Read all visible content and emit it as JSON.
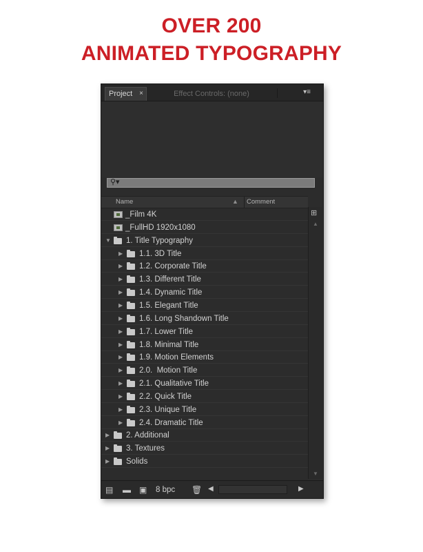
{
  "headline": {
    "line1": "OVER 200",
    "line2": "ANIMATED TYPOGRAPHY",
    "color": "#cc1f26"
  },
  "panel": {
    "tabs": {
      "project": "Project",
      "project_close": "×",
      "effect_controls": "Effect Controls: (none)",
      "menu": "▾≡"
    },
    "search": {
      "icon": "magnifier-icon",
      "glyph": "⚲▾"
    },
    "columns": {
      "name": "Name",
      "sort": "▲",
      "comment": "Comment"
    },
    "items": [
      {
        "label": "_Film 4K",
        "type": "composition",
        "level": 0,
        "expand": ""
      },
      {
        "label": "_FullHD 1920x1080",
        "type": "composition",
        "level": 0,
        "expand": ""
      },
      {
        "label": "1. Title Typography",
        "type": "folder",
        "level": 0,
        "expand": "▼"
      },
      {
        "label": "1.1. 3D Title",
        "type": "folder",
        "level": 1,
        "expand": "▶"
      },
      {
        "label": "1.2. Corporate Title",
        "type": "folder",
        "level": 1,
        "expand": "▶"
      },
      {
        "label": "1.3. Different Title",
        "type": "folder",
        "level": 1,
        "expand": "▶"
      },
      {
        "label": "1.4. Dynamic Title",
        "type": "folder",
        "level": 1,
        "expand": "▶"
      },
      {
        "label": "1.5. Elegant Title",
        "type": "folder",
        "level": 1,
        "expand": "▶"
      },
      {
        "label": "1.6. Long Shandown Title",
        "type": "folder",
        "level": 1,
        "expand": "▶"
      },
      {
        "label": "1.7. Lower Title",
        "type": "folder",
        "level": 1,
        "expand": "▶"
      },
      {
        "label": "1.8. Minimal Title",
        "type": "folder",
        "level": 1,
        "expand": "▶"
      },
      {
        "label": "1.9. Motion Elements",
        "type": "folder",
        "level": 1,
        "expand": "▶"
      },
      {
        "label": "2.0.  Motion Title",
        "type": "folder",
        "level": 1,
        "expand": "▶"
      },
      {
        "label": "2.1. Qualitative Title",
        "type": "folder",
        "level": 1,
        "expand": "▶"
      },
      {
        "label": "2.2. Quick Title",
        "type": "folder",
        "level": 1,
        "expand": "▶"
      },
      {
        "label": "2.3. Unique Title",
        "type": "folder",
        "level": 1,
        "expand": "▶"
      },
      {
        "label": "2.4. Dramatic Title",
        "type": "folder",
        "level": 1,
        "expand": "▶"
      },
      {
        "label": "2. Additional",
        "type": "folder",
        "level": 0,
        "expand": "▶"
      },
      {
        "label": "3. Textures",
        "type": "folder",
        "level": 0,
        "expand": "▶"
      },
      {
        "label": "Solids",
        "type": "folder",
        "level": 0,
        "expand": "▶"
      }
    ],
    "scrollbar": {
      "tree": "flowchart-icon",
      "up": "▲",
      "down": "▼"
    },
    "bottom": {
      "bpc": "8 bpc",
      "left": "◀",
      "right": "▶"
    }
  }
}
